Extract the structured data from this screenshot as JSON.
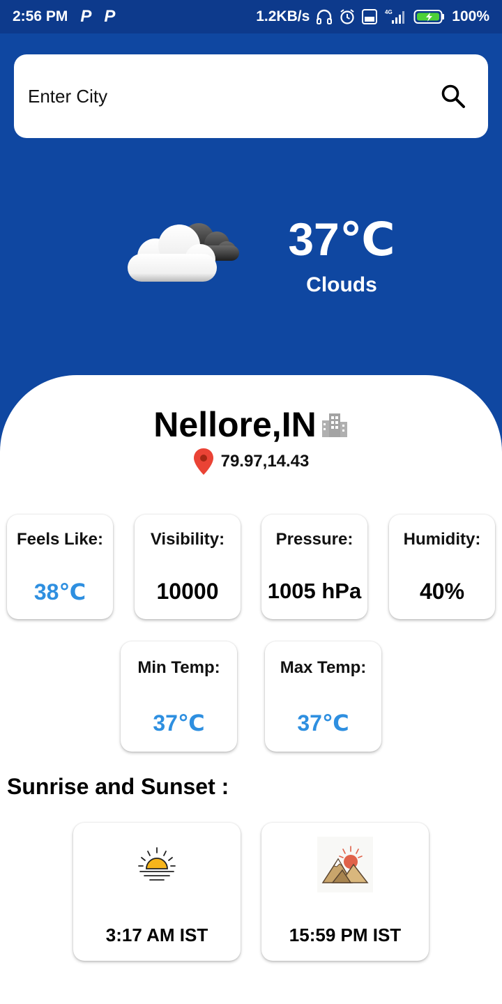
{
  "status_bar": {
    "time": "2:56 PM",
    "speed": "1.2KB/s",
    "network": "4G",
    "battery": "100%"
  },
  "search": {
    "placeholder": "Enter City",
    "icon": "search-icon"
  },
  "current": {
    "temperature": "37℃",
    "condition": "Clouds",
    "icon": "clouds-icon"
  },
  "location": {
    "city": "Nellore,IN",
    "coords": "79.97,14.43"
  },
  "stats": [
    {
      "label": "Feels Like:",
      "value": "38℃"
    },
    {
      "label": "Visibility:",
      "value": "10000"
    },
    {
      "label": "Pressure:",
      "value": "1005 hPa"
    },
    {
      "label": "Humidity:",
      "value": "40%"
    }
  ],
  "temps": [
    {
      "label": "Min Temp:",
      "value": "37℃"
    },
    {
      "label": "Max Temp:",
      "value": "37℃"
    }
  ],
  "sun": {
    "title": "Sunrise and Sunset :",
    "sunrise": "3:17 AM IST",
    "sunset": "15:59 PM IST"
  },
  "colors": {
    "primary": "#0f47a1",
    "status_bar": "#0d3a8c",
    "accent_value": "#2e8fe0"
  }
}
